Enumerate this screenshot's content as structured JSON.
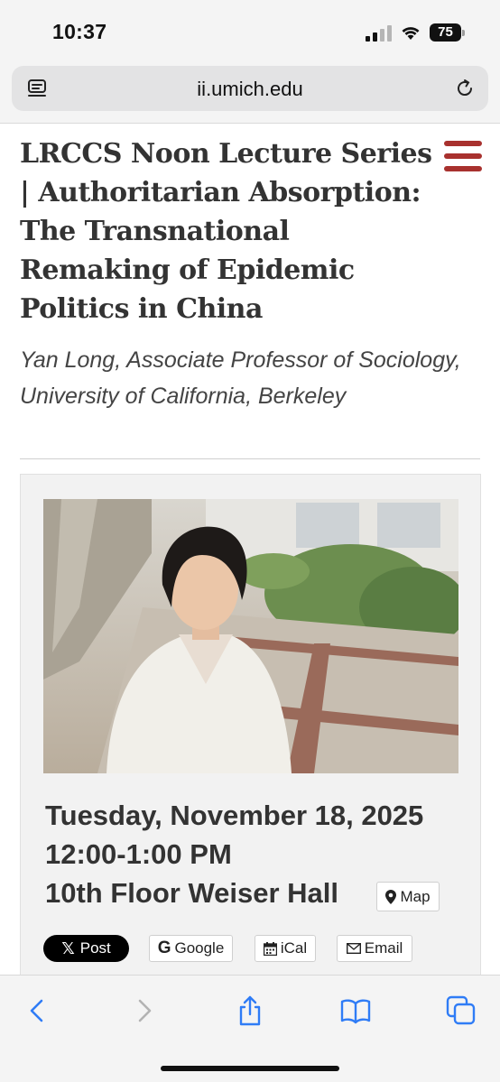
{
  "status_bar": {
    "time": "10:37",
    "battery": "75",
    "icons": [
      "signal-icon",
      "wifi-icon",
      "battery-icon"
    ]
  },
  "browser": {
    "url": "ii.umich.edu",
    "icons": [
      "reader-mode-icon",
      "reload-icon"
    ],
    "toolbar_icons": [
      "back-icon",
      "forward-icon",
      "share-icon",
      "bookmarks-icon",
      "tabs-icon"
    ]
  },
  "page": {
    "title": "LRCCS Noon Lecture Series | Authoritarian Absorption: The Transnational Remaking of Epidemic Politics in China",
    "subtitle": "Yan Long, Associate Professor of Sociology, University of California, Berkeley",
    "accent_color": "#a8312e"
  },
  "event": {
    "date": "Tuesday, November 18, 2025",
    "time": "12:00-1:00 PM",
    "location": "10th Floor Weiser Hall",
    "map_label": "Map"
  },
  "share": {
    "x_label": "Post",
    "google_label": "Google",
    "ical_label": "iCal",
    "email_label": "Email"
  }
}
